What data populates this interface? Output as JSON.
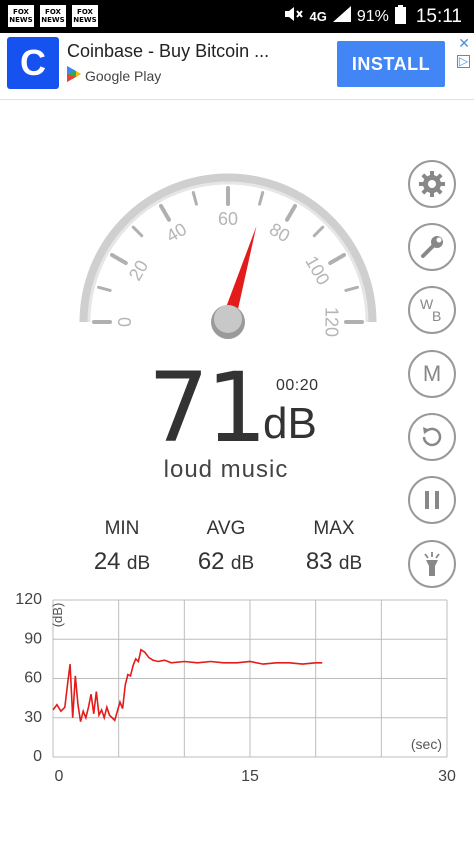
{
  "status_bar": {
    "news_icons": [
      "FOX NEWS",
      "FOX NEWS",
      "FOX NEWS"
    ],
    "network": "4G",
    "battery": "91%",
    "time": "15:11"
  },
  "ad": {
    "logo_letter": "C",
    "title": "Coinbase - Buy Bitcoin ...",
    "store": "Google Play",
    "install_label": "INSTALL",
    "brand_color": "#1652f0",
    "button_color": "#4285f4"
  },
  "gauge": {
    "min": 0,
    "max": 120,
    "tick_labels": [
      "0",
      "20",
      "40",
      "60",
      "80",
      "100",
      "120"
    ],
    "needle_value": 71,
    "needle_color": "#e31b1b"
  },
  "reading": {
    "value": "71",
    "unit": "dB",
    "timer": "00:20",
    "description": "loud music"
  },
  "stats": [
    {
      "label": "MIN",
      "value": "24",
      "unit": "dB"
    },
    {
      "label": "AVG",
      "value": "62",
      "unit": "dB"
    },
    {
      "label": "MAX",
      "value": "83",
      "unit": "dB"
    }
  ],
  "side_buttons": [
    {
      "name": "settings-button",
      "icon": "gear-icon"
    },
    {
      "name": "calibrate-button",
      "icon": "wrench-icon"
    },
    {
      "name": "weighting-button",
      "icon": "wb-icon",
      "text": "W B"
    },
    {
      "name": "memory-button",
      "icon": "m-icon",
      "text": "M"
    },
    {
      "name": "reset-button",
      "icon": "reset-icon"
    },
    {
      "name": "pause-button",
      "icon": "pause-icon"
    },
    {
      "name": "flashlight-button",
      "icon": "flashlight-icon"
    }
  ],
  "chart_data": {
    "type": "line",
    "x_unit_label": "(sec)",
    "y_unit_label": "(dB)",
    "xlim": [
      0,
      30
    ],
    "ylim": [
      0,
      120
    ],
    "x_ticks": [
      "0",
      "15",
      "30"
    ],
    "y_ticks": [
      "120",
      "90",
      "60",
      "30",
      "0"
    ],
    "grid": true,
    "line_color": "#e31b1b",
    "series": [
      {
        "x": [
          0,
          0.3,
          0.6,
          0.9,
          1.1,
          1.3,
          1.5,
          1.7,
          1.9,
          2.1,
          2.3,
          2.5,
          2.7,
          2.9,
          3.1,
          3.3,
          3.5,
          3.7,
          3.9,
          4.1,
          4.3,
          4.5,
          4.7,
          4.9,
          5.1,
          5.3,
          5.5,
          5.7,
          5.9,
          6.1,
          6.3,
          6.5,
          6.7,
          7.0,
          7.3,
          7.6,
          8.0,
          8.5,
          9,
          10,
          11,
          12,
          13,
          14,
          15,
          16,
          17,
          18,
          19,
          20,
          20.5
        ],
        "y": [
          36,
          40,
          35,
          38,
          55,
          71,
          30,
          62,
          40,
          27,
          35,
          30,
          38,
          48,
          33,
          50,
          32,
          36,
          30,
          38,
          32,
          30,
          28,
          35,
          42,
          37,
          55,
          63,
          62,
          70,
          75,
          73,
          82,
          80,
          76,
          74,
          73,
          74,
          72,
          73,
          72,
          73,
          72,
          72,
          73,
          71,
          72,
          72,
          71,
          72,
          72
        ]
      }
    ]
  }
}
